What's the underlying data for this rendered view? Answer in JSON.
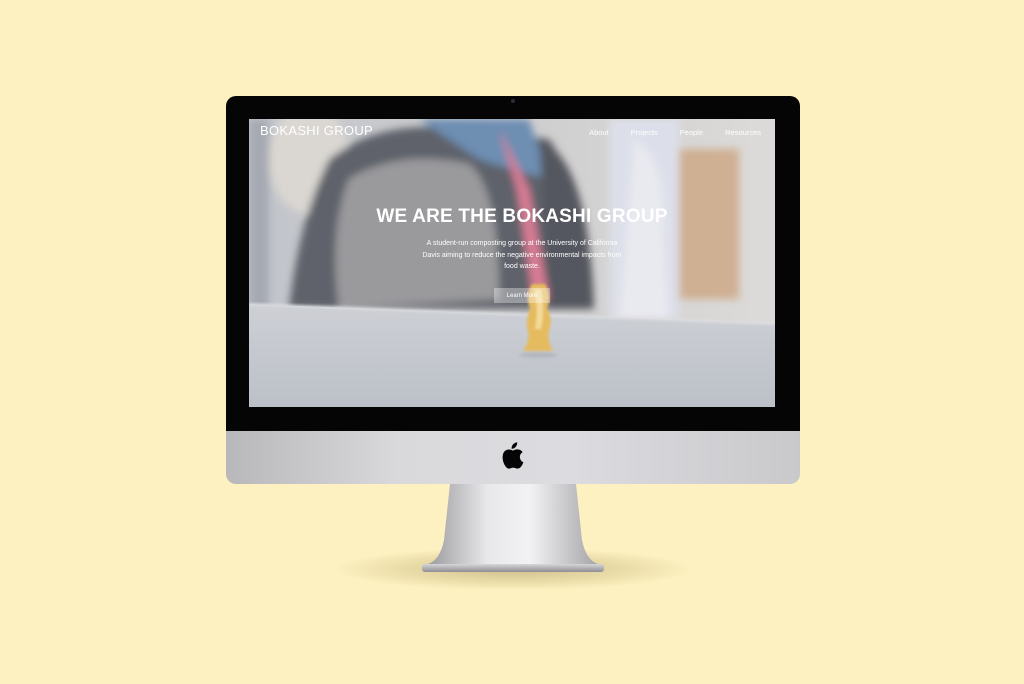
{
  "site": {
    "brand": "BOKASHI GROUP",
    "nav": [
      "About",
      "Projects",
      "People",
      "Resources"
    ]
  },
  "hero": {
    "title": "WE ARE THE BOKASHI GROUP",
    "subtitle": "A student-run composting group at the University of California Davis aiming to reduce the negative environmental impacts from food waste.",
    "button_label": "Learn More"
  },
  "colors": {
    "background": "#fdf1c1",
    "bezel": "#050505",
    "chin": "#d9d9dc",
    "text": "#ffffff"
  },
  "icons": {
    "monitor_logo": "apple-logo-icon"
  }
}
